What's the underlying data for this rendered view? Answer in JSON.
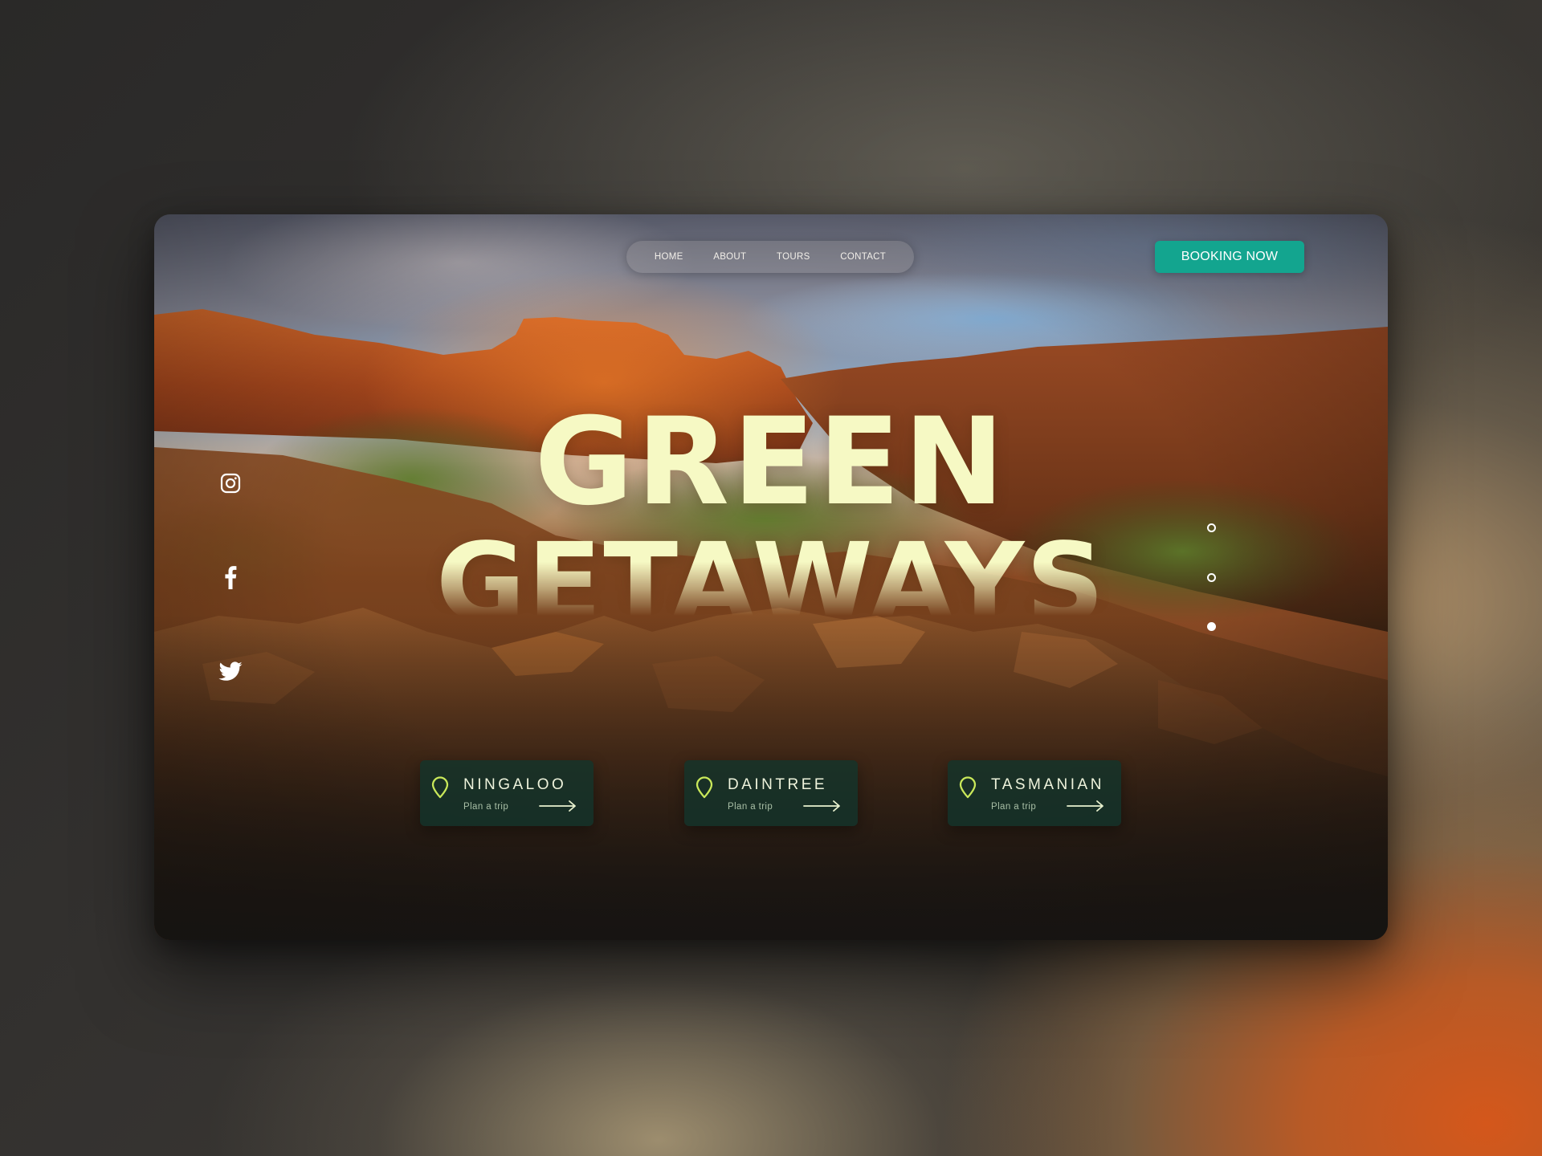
{
  "nav": {
    "items": [
      {
        "label": "HOME"
      },
      {
        "label": "ABOUT"
      },
      {
        "label": "TOURS"
      },
      {
        "label": "CONTACT"
      }
    ]
  },
  "booking_button": {
    "label": "BOOKING NOW"
  },
  "hero": {
    "title_line1": "GREEN",
    "title_line2": "GETAWAYS"
  },
  "social": [
    {
      "icon": "instagram-icon"
    },
    {
      "icon": "facebook-icon"
    },
    {
      "icon": "twitter-icon"
    }
  ],
  "slides": {
    "count": 3,
    "active_index": 2
  },
  "destinations": [
    {
      "name": "NINGALOO",
      "action": "Plan a trip",
      "icon": "location-pin-icon"
    },
    {
      "name": "DAINTREE",
      "action": "Plan a trip",
      "icon": "location-pin-icon"
    },
    {
      "name": "TASMANIAN",
      "action": "Plan a trip",
      "icon": "location-pin-icon"
    }
  ],
  "colors": {
    "accent": "#13a58f",
    "headline": "#f6f9c4",
    "card_bg": "#12342c",
    "pin": "#c9e85a"
  }
}
